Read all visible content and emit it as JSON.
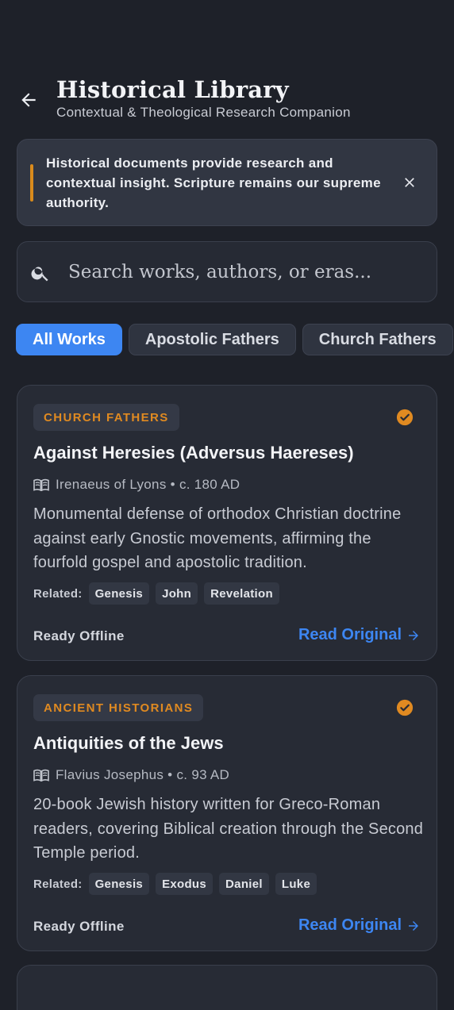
{
  "header": {
    "title": "Historical Library",
    "subtitle": "Contextual & Theological Research Companion"
  },
  "notice": {
    "text": "Historical documents provide research and contextual insight. Scripture remains our supreme authority.",
    "accent_color": "#d98a1c"
  },
  "search": {
    "placeholder": "Search works, authors, or eras...",
    "value": ""
  },
  "filters": [
    {
      "label": "All Works",
      "active": true
    },
    {
      "label": "Apostolic Fathers",
      "active": false
    },
    {
      "label": "Church Fathers",
      "active": false
    }
  ],
  "cards": [
    {
      "category": "CHURCH FATHERS",
      "title": "Against Heresies (Adversus Haereses)",
      "author": "Irenaeus of Lyons",
      "era": "c. 180 AD",
      "description": "Monumental defense of orthodox Christian doctrine against early Gnostic movements, affirming the fourfold gospel and apostolic tradition.",
      "related_label": "Related:",
      "related": [
        "Genesis",
        "John",
        "Revelation"
      ],
      "status": "Ready Offline",
      "action": "Read Original"
    },
    {
      "category": "ANCIENT HISTORIANS",
      "title": "Antiquities of the Jews",
      "author": "Flavius Josephus",
      "era": "c. 93 AD",
      "description": "20-book Jewish history written for Greco-Roman readers, covering Biblical creation through the Second Temple period.",
      "related_label": "Related:",
      "related": [
        "Genesis",
        "Exodus",
        "Daniel",
        "Luke"
      ],
      "status": "Ready Offline",
      "action": "Read Original"
    }
  ],
  "colors": {
    "background": "#1e2129",
    "accent_blue": "#3d86f2",
    "accent_orange": "#e08a21"
  },
  "icons": {
    "back": "arrow-left-icon",
    "close": "close-icon",
    "search": "search-icon",
    "check": "check-circle-icon",
    "book": "open-book-icon",
    "arrow": "arrow-right-icon"
  }
}
